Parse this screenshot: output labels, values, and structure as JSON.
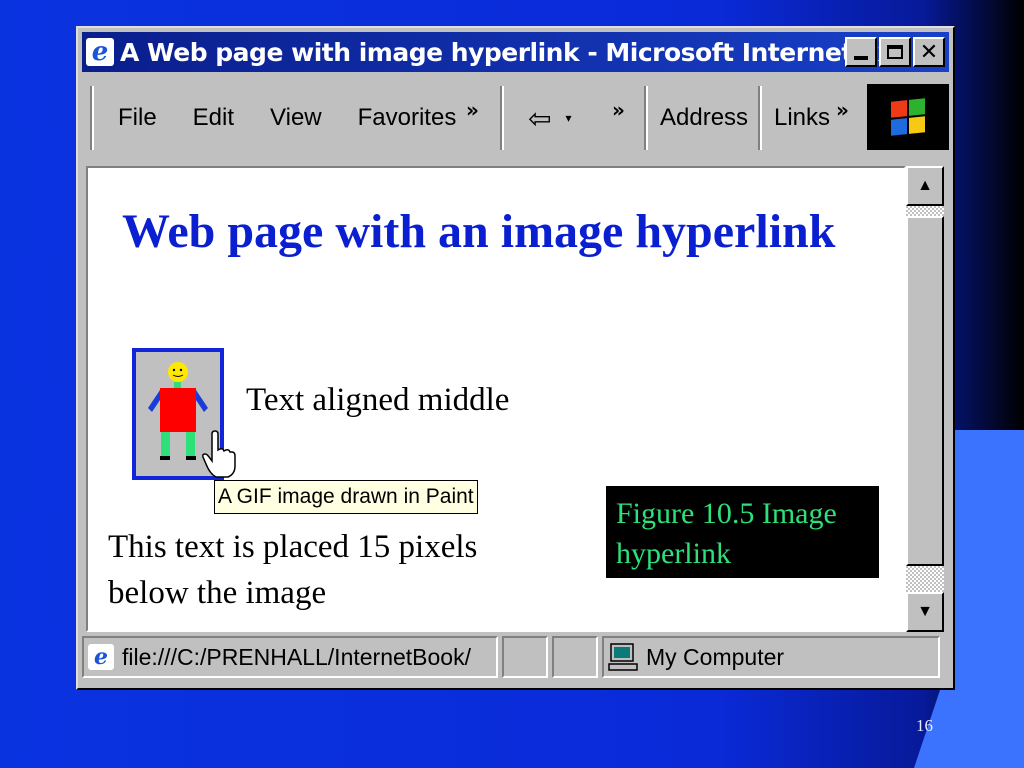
{
  "window": {
    "title": "A Web page with image hyperlink - Microsoft Internet Ex...",
    "controls": [
      "minimize",
      "maximize",
      "close"
    ]
  },
  "toolbar": {
    "menu": [
      "File",
      "Edit",
      "View",
      "Favorites"
    ],
    "more_chevron": "»",
    "back_arrow": "⇦",
    "dropdown": "▾",
    "address_label": "Address",
    "links_label": "Links"
  },
  "page": {
    "heading": "Web page with an image hyperlink",
    "aligned_text": "Text aligned middle",
    "tooltip": "A GIF image drawn in Paint",
    "below_text": "This text is placed 15 pixels below the image",
    "caption": "Figure 10.5 Image hyperlink"
  },
  "status": {
    "url": "file:///C:/PRENHALL/InternetBook/",
    "zone": "My Computer"
  },
  "slide": {
    "number": "16"
  },
  "colors": {
    "title_bar": "#0a1e8c",
    "heading": "#0a1fd0",
    "caption_text": "#2ee07a",
    "link_border": "#1026d8"
  }
}
